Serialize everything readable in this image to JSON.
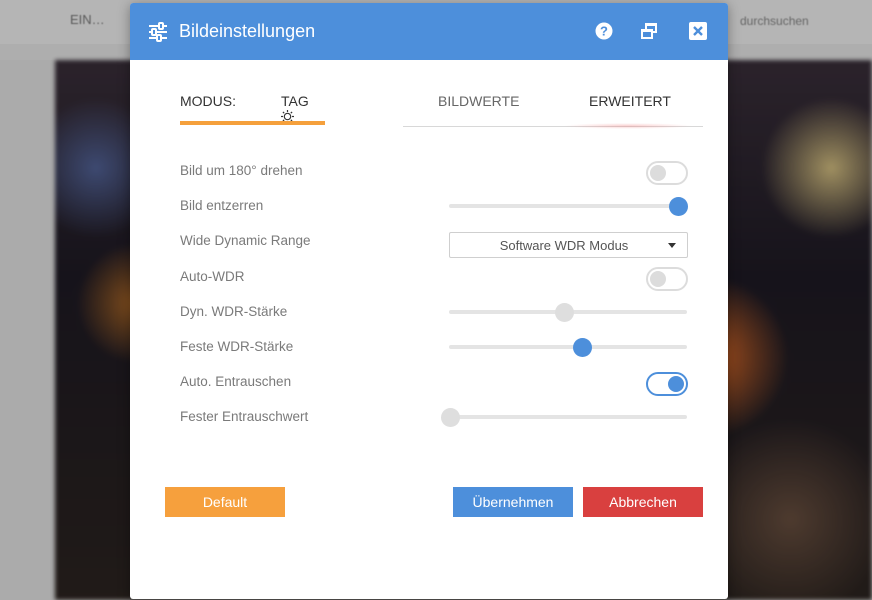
{
  "background": {
    "top_left_text": "EIN…",
    "top_right_text": "durchsuchen"
  },
  "dialog": {
    "title": "Bildeinstellungen",
    "header_icons": [
      "sliders-icon",
      "help-icon",
      "window-restore-icon",
      "close-icon"
    ]
  },
  "mode": {
    "label": "MODUS:",
    "value": "TAG",
    "value_icon": "sun-icon"
  },
  "tabs": [
    {
      "label": "BILDWERTE",
      "active": false
    },
    {
      "label": "ERWEITERT",
      "active": true
    }
  ],
  "settings": [
    {
      "label": "Bild um 180° drehen",
      "control": "toggle",
      "on": false
    },
    {
      "label": "Bild entzerren",
      "control": "slider",
      "value_fraction": 1.0,
      "active": true
    },
    {
      "label": "Wide Dynamic Range",
      "control": "select",
      "selected": "Software WDR Modus"
    },
    {
      "label": "Auto-WDR",
      "control": "toggle",
      "on": false
    },
    {
      "label": "Dyn. WDR-Stärke",
      "control": "slider",
      "value_fraction": 0.5,
      "active": false
    },
    {
      "label": "Feste WDR-Stärke",
      "control": "slider",
      "value_fraction": 0.58,
      "active": true
    },
    {
      "label": "Auto. Entrauschen",
      "control": "toggle",
      "on": true
    },
    {
      "label": "Fester Entrauschwert",
      "control": "slider",
      "value_fraction": 0.0,
      "active": false
    }
  ],
  "buttons": {
    "default": "Default",
    "apply": "Übernehmen",
    "cancel": "Abbrechen"
  },
  "colors": {
    "header": "#4d8fdb",
    "accent_orange": "#f6a03d",
    "cancel_red": "#d9403f"
  }
}
